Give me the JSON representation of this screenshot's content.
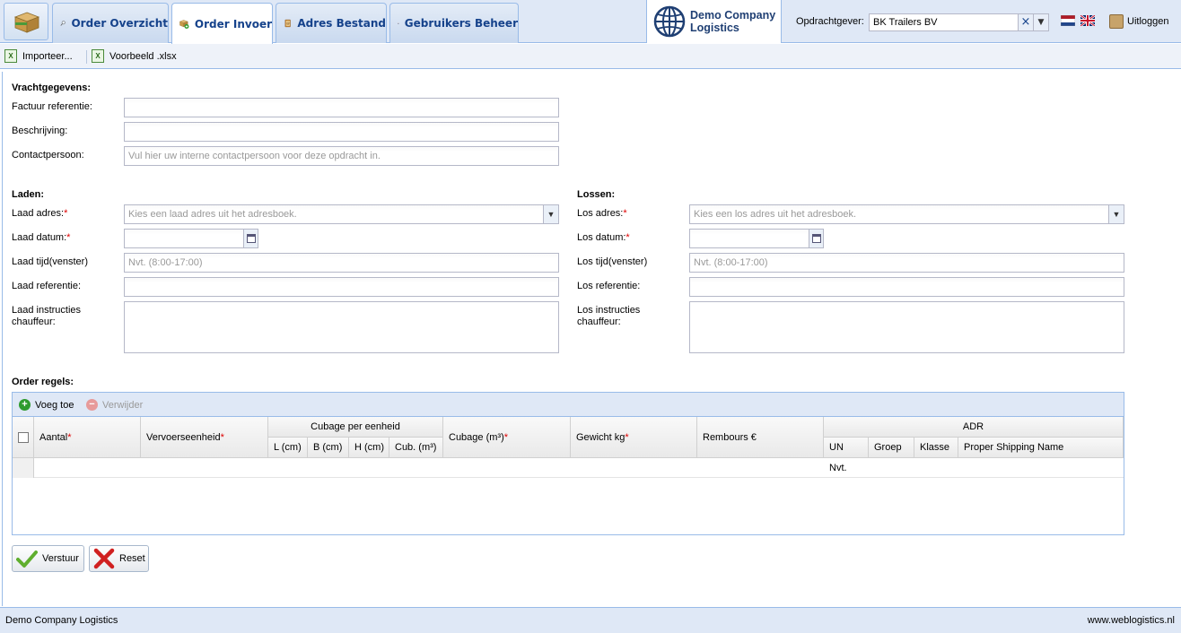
{
  "tabs": [
    {
      "label": "Order Overzicht",
      "icon": "magnifier-icon"
    },
    {
      "label": "Order Invoer",
      "icon": "package-add-icon",
      "active": true
    },
    {
      "label": "Adres Bestand",
      "icon": "address-book-icon"
    },
    {
      "label": "Gebruikers Beheer",
      "icon": "user-icon"
    }
  ],
  "company": {
    "line1": "Demo Company",
    "line2": "Logistics"
  },
  "client": {
    "label": "Opdrachtgever:",
    "value": "BK Trailers BV"
  },
  "logout_label": "Uitloggen",
  "toolbar": {
    "import_label": "Importeer...",
    "example_label": "Voorbeeld .xlsx"
  },
  "freight": {
    "section_title": "Vrachtgegevens:",
    "invoice_ref_label": "Factuur referentie:",
    "invoice_ref_value": "",
    "description_label": "Beschrijving:",
    "description_value": "",
    "contact_label": "Contactpersoon:",
    "contact_placeholder": "Vul hier uw interne contactpersoon voor deze opdracht in."
  },
  "loading": {
    "section_title": "Laden:",
    "address_label": "Laad adres:",
    "address_placeholder": "Kies een laad adres uit het adresboek.",
    "date_label": "Laad datum:",
    "time_label": "Laad tijd(venster)",
    "time_placeholder": "Nvt. (8:00-17:00)",
    "reference_label": "Laad referentie:",
    "instructions_label_1": "Laad instructies",
    "instructions_label_2": "chauffeur:"
  },
  "unloading": {
    "section_title": "Lossen:",
    "address_label": "Los adres:",
    "address_placeholder": "Kies een los adres uit het adresboek.",
    "date_label": "Los datum:",
    "time_label": "Los tijd(venster)",
    "time_placeholder": "Nvt. (8:00-17:00)",
    "reference_label": "Los referentie:",
    "instructions_label_1": "Los instructies",
    "instructions_label_2": "chauffeur:"
  },
  "order_lines": {
    "section_title": "Order regels:",
    "add_label": "Voeg toe",
    "remove_label": "Verwijder",
    "columns": {
      "aantal": "Aantal",
      "vervoerseenheid": "Vervoerseenheid",
      "cubage_group": "Cubage per eenheid",
      "l": "L (cm)",
      "b": "B (cm)",
      "h": "H (cm)",
      "cub": "Cub. (m³)",
      "cubage": "Cubage (m³)",
      "gewicht": "Gewicht kg",
      "rembours": "Rembours €",
      "adr": "ADR",
      "un": "UN",
      "groep": "Groep",
      "klasse": "Klasse",
      "psn": "Proper Shipping Name"
    },
    "rows": [
      {
        "un": "Nvt."
      }
    ]
  },
  "buttons": {
    "submit": "Verstuur",
    "reset": "Reset"
  },
  "footer": {
    "left": "Demo Company Logistics",
    "right": "www.weblogistics.nl"
  },
  "required_marker": "*"
}
